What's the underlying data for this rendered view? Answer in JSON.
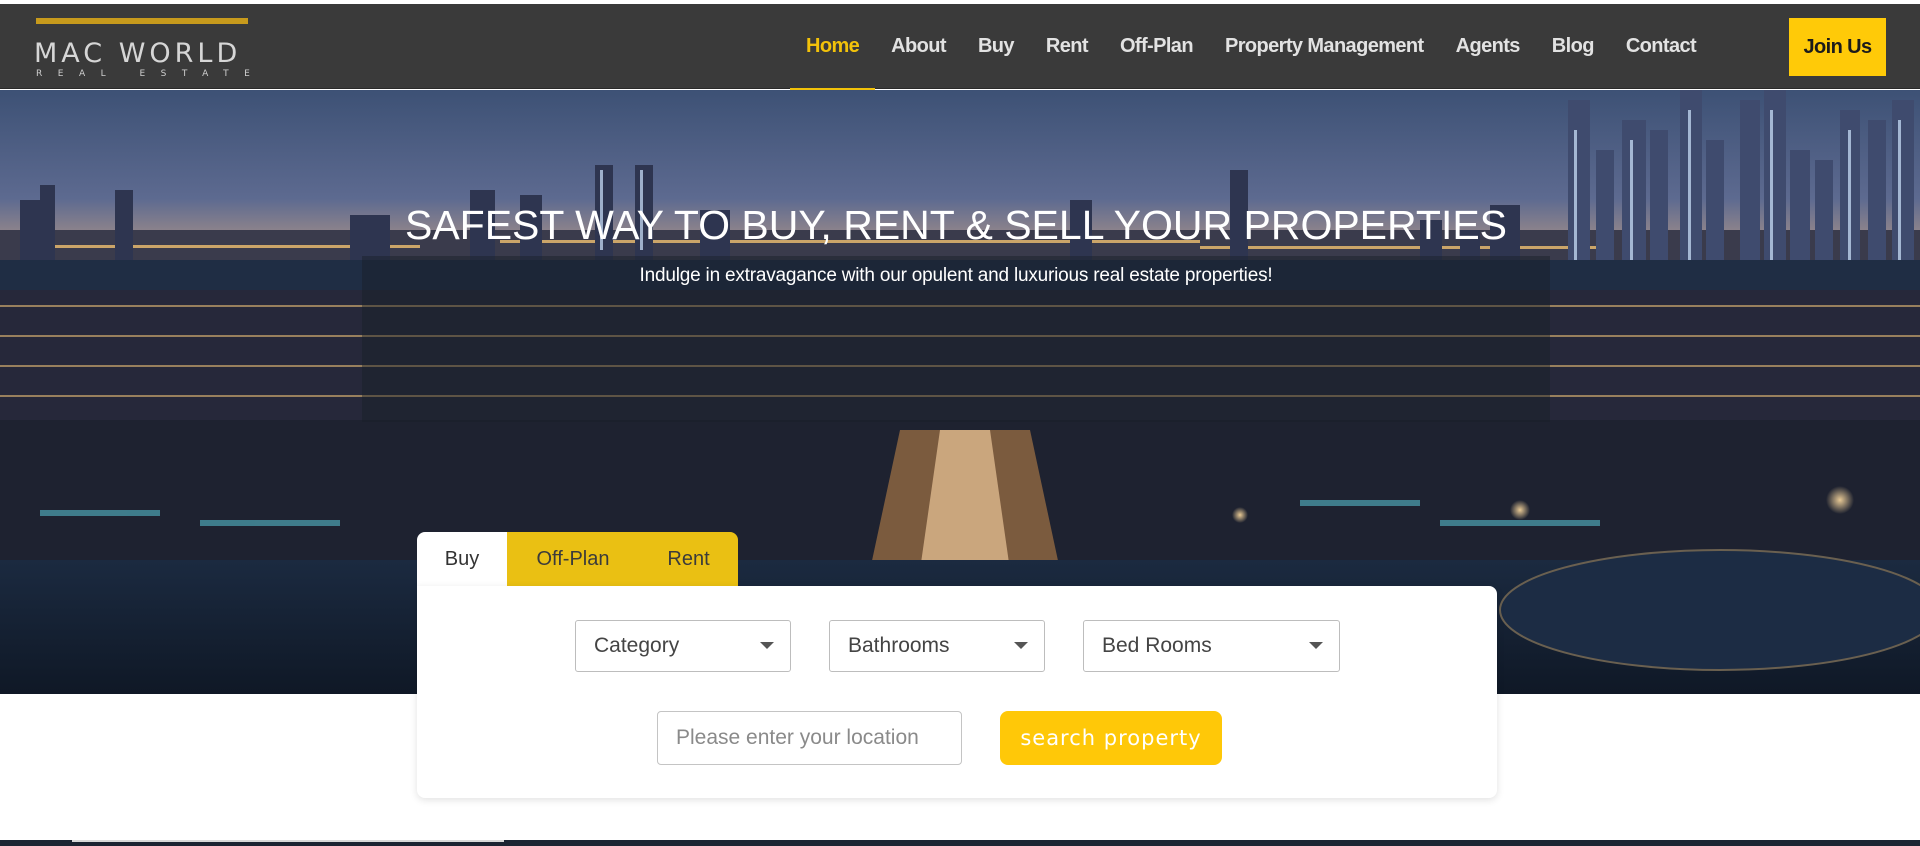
{
  "brand": {
    "name": "MAC WORLD",
    "tagline": "REAL ESTATE",
    "accent_color": "#f2c20a"
  },
  "nav": {
    "items": [
      {
        "label": "Home",
        "active": true
      },
      {
        "label": "About"
      },
      {
        "label": "Buy"
      },
      {
        "label": "Rent"
      },
      {
        "label": "Off-Plan"
      },
      {
        "label": "Property Management"
      },
      {
        "label": "Agents"
      },
      {
        "label": "Blog"
      },
      {
        "label": "Contact"
      }
    ],
    "cta_label": "Join Us"
  },
  "hero": {
    "title": "SAFEST WAY TO BUY, RENT & SELL YOUR PROPERTIES",
    "subtitle": "Indulge in extravagance with our opulent and luxurious real estate properties!"
  },
  "search": {
    "tabs": [
      {
        "label": "Buy",
        "selected": true
      },
      {
        "label": "Off-Plan"
      },
      {
        "label": "Rent"
      }
    ],
    "category": {
      "value": "Category"
    },
    "bathrooms": {
      "value": "Bathrooms"
    },
    "bedrooms": {
      "value": "Bed Rooms"
    },
    "location": {
      "placeholder": "Please enter your location",
      "value": ""
    },
    "submit_label": "search property"
  }
}
